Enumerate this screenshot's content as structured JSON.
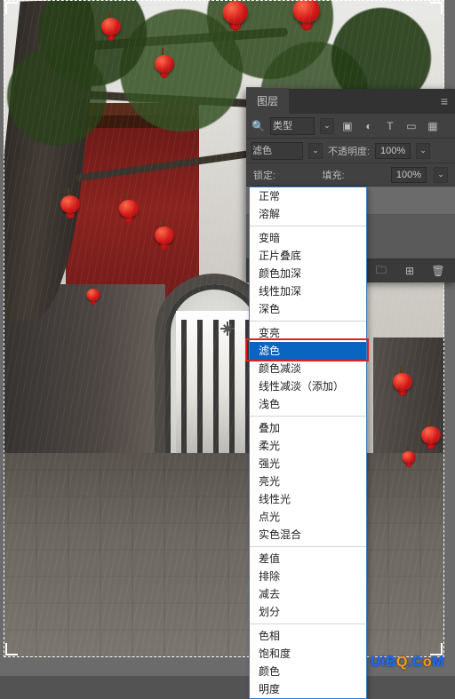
{
  "panel": {
    "tab": "图层",
    "filter": {
      "type_label": "类型",
      "icons": [
        "image-filter-icon",
        "adjustment-filter-icon",
        "type-filter-icon",
        "shape-filter-icon",
        "smart-filter-icon"
      ]
    },
    "blend_selected": "滤色",
    "opacity_label": "不透明度:",
    "opacity_value": "100%",
    "lock_label": "锁定:",
    "fill_label": "填充:",
    "fill_value": "100%",
    "footer_icons": [
      "folder-icon",
      "new-layer-icon",
      "trash-icon"
    ]
  },
  "blend_modes": {
    "groups": [
      [
        "正常",
        "溶解"
      ],
      [
        "变暗",
        "正片叠底",
        "颜色加深",
        "线性加深",
        "深色"
      ],
      [
        "变亮",
        "滤色",
        "颜色减淡",
        "线性减淡（添加）",
        "浅色"
      ],
      [
        "叠加",
        "柔光",
        "强光",
        "亮光",
        "线性光",
        "点光",
        "实色混合"
      ],
      [
        "差值",
        "排除",
        "减去",
        "划分"
      ],
      [
        "色相",
        "饱和度",
        "颜色",
        "明度"
      ]
    ],
    "selected": "滤色"
  },
  "watermark": "UiBQ.CoM"
}
